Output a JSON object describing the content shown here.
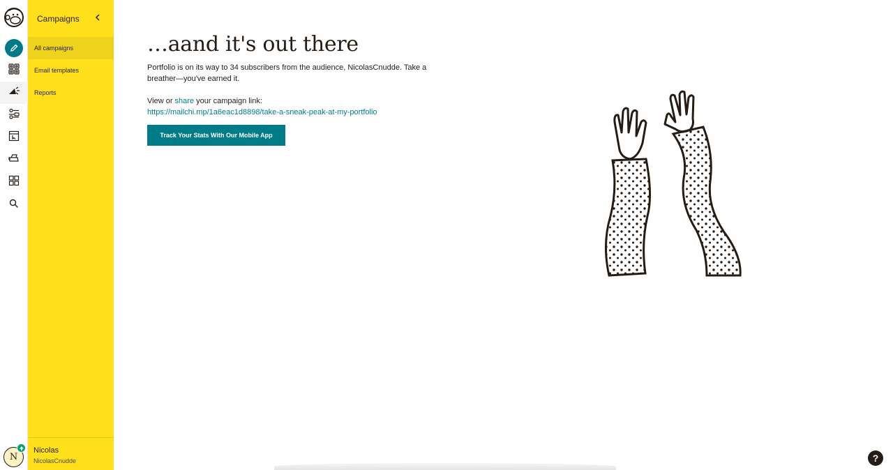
{
  "rail": {
    "icons": [
      "mailchimp-logo",
      "pencil-icon",
      "audience-icon",
      "campaigns-megaphone-icon",
      "automations-icon",
      "landing-pages-icon",
      "content-studio-icon",
      "integrations-grid-icon",
      "search-icon"
    ],
    "avatar_initial": "N"
  },
  "sidebar": {
    "title": "Campaigns",
    "items": [
      {
        "label": "All campaigns",
        "selected": true
      },
      {
        "label": "Email templates"
      },
      {
        "label": "Reports"
      }
    ],
    "user": {
      "name": "Nicolas",
      "handle": "NicolasCnudde"
    }
  },
  "main": {
    "headline": "…aand it's out there",
    "body": "Portfolio is on its way to 34 subscribers from the audience, NicolasCnudde. Take a breather—you've earned it.",
    "link_prefix": "View or ",
    "link_share": "share",
    "link_suffix": " your campaign link:",
    "campaign_url": "https://mailchi.mp/1a6eac1d8898/take-a-sneak-peak-at-my-portfolio",
    "cta_label": "Track Your Stats With Our Mobile App",
    "help_label": "?"
  },
  "colors": {
    "brand_yellow": "#ffe01b",
    "accent_teal": "#007c89",
    "text": "#241c15"
  }
}
